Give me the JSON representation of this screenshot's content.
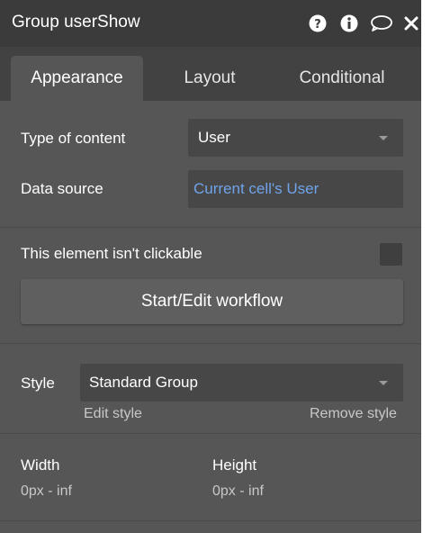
{
  "header": {
    "title": "Group userShow",
    "icons": [
      "help-icon",
      "info-icon",
      "comment-icon",
      "close-icon"
    ]
  },
  "tabs": [
    {
      "label": "Appearance",
      "active": true
    },
    {
      "label": "Layout",
      "active": false
    },
    {
      "label": "Conditional",
      "active": false
    }
  ],
  "data_section": {
    "type_label": "Type of content",
    "type_value": "User",
    "source_label": "Data source",
    "source_value": "Current cell's User"
  },
  "click_section": {
    "not_clickable_label": "This element isn't clickable",
    "not_clickable_checked": false,
    "workflow_button_label": "Start/Edit workflow"
  },
  "style_section": {
    "label": "Style",
    "value": "Standard Group",
    "edit_link": "Edit style",
    "remove_link": "Remove style"
  },
  "size_section": {
    "width_label": "Width",
    "width_value": "0px - inf",
    "height_label": "Height",
    "height_value": "0px - inf"
  },
  "colors": {
    "panel": "#565656",
    "header": "#3b3b3b",
    "tabbar": "#424242",
    "field": "#474747",
    "link": "#6fa3ea"
  }
}
